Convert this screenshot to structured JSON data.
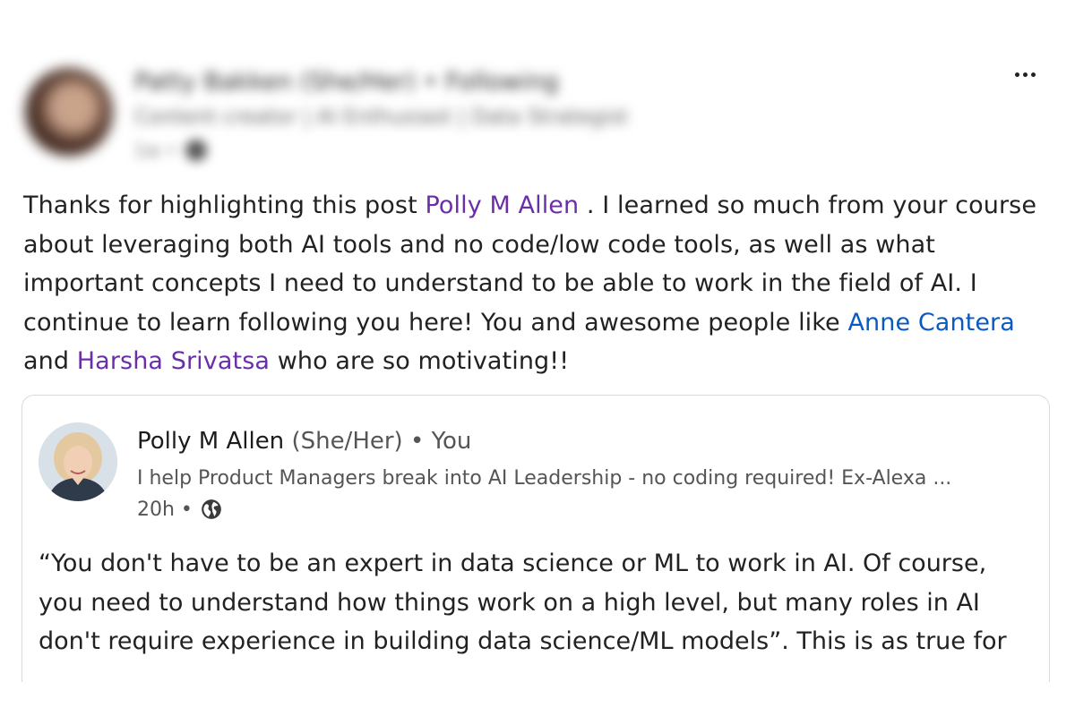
{
  "author": {
    "name": "Patty Bakken (She/Her) • Following",
    "headline": "Content creator | AI Enthusiast | Data Strategist",
    "time": "1w •"
  },
  "menu": {
    "more_label": "More actions"
  },
  "comment": {
    "p1": "Thanks for highlighting this post ",
    "m1": "Polly M Allen",
    "p2": " . I learned so much from your course about leveraging both AI tools and no code/low code tools, as well as what important concepts I need to understand to be able to work in the field of AI. I continue to learn following you here! You and awesome people like ",
    "m2": "Anne Cantera",
    "p3": " and ",
    "m3": "Harsha Srivatsa",
    "p4": " who are so motivating!!"
  },
  "quoted_post": {
    "name": "Polly M Allen",
    "pronouns": "(She/Her)",
    "relation": "• You",
    "headline": "I help Product Managers break into AI Leadership - no coding required! Ex-Alexa ...",
    "time": "20h •",
    "body": "“You don't have to be an expert in data science or ML to work in AI. Of course, you need to understand how things work on a high level, but many roles in AI don't require experience in building data science/ML models”. This is as true for"
  },
  "colors": {
    "mention_purple": "#6a2fa8",
    "mention_blue": "#0a5ac2"
  },
  "icons": [
    "more-icon",
    "globe-icon"
  ]
}
